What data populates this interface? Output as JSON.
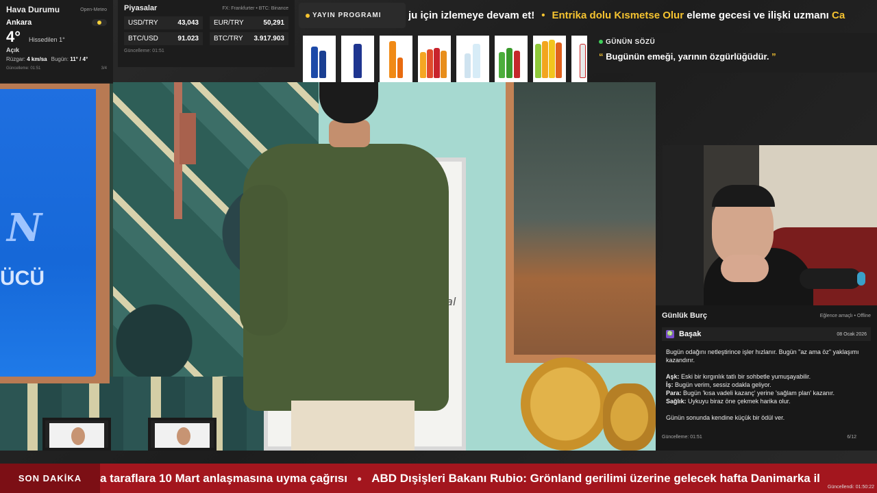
{
  "weather": {
    "title": "Hava Durumu",
    "source": "Open-Meteo",
    "city": "Ankara",
    "temperature": "4°",
    "feels_like": "Hissedilen 1°",
    "condition": "Açık",
    "wind_label": "Rüzgar:",
    "wind_value": "4 km/sa",
    "today_label": "Bugün:",
    "today_value": "11° / 4°",
    "updated": "Güncelleme: 01:51",
    "page": "3/4"
  },
  "markets": {
    "title": "Piyasalar",
    "source": "FX: Frankfurter • BTC: Binance",
    "rates": [
      {
        "pair": "USD/TRY",
        "value": "43,043"
      },
      {
        "pair": "EUR/TRY",
        "value": "50,291"
      },
      {
        "pair": "BTC/USD",
        "value": "91.023"
      },
      {
        "pair": "BTC/TRY",
        "value": "3.917.903"
      }
    ],
    "updated": "Güncelleme: 01:51"
  },
  "program": {
    "label": "YAYIN PROGRAMI",
    "ticker_part1": "ju için izlemeye devam et!",
    "ticker_highlight": "Entrika dolu Kısmetse Olur",
    "ticker_part2": "eleme gecesi ve ilişki uzmanı",
    "ticker_tail": "Ca"
  },
  "quote": {
    "title": "GÜNÜN SÖZÜ",
    "text": "Bugünün emeği, yarının özgürlüğüdür."
  },
  "video_scene": {
    "sign_text": "ÜCÜ",
    "board_scribble": "nal"
  },
  "horoscope": {
    "title": "Günlük Burç",
    "meta": "Eğlence amaçlı • Offline",
    "sign_icon": "♍",
    "sign": "Başak",
    "date": "08 Ocak 2026",
    "intro": "Bugün odağını netleştirince işler hızlanır. Bugün \"az ama öz\" yaklaşımı kazandırır.",
    "love_label": "Aşk:",
    "love": "Eski bir kırgınlık tatlı bir sohbetle yumuşayabilir.",
    "work_label": "İş:",
    "work": "Bugün verim, sessiz odakla geliyor.",
    "money_label": "Para:",
    "money": "Bugün 'kısa vadeli kazanç' yerine 'sağlam plan' kazanır.",
    "health_label": "Sağlık:",
    "health": "Uykuyu biraz öne çekmek harika olur.",
    "outro": "Günün sonunda kendine küçük bir ödül ver.",
    "updated": "Güncelleme: 01:51",
    "page": "6/12"
  },
  "news": {
    "label": "SON DAKİKA",
    "item1": "a taraflara 10 Mart anlaşmasına uyma çağrısı",
    "item2": "ABD Dışişleri Bakanı Rubio: Grönland gerilimi üzerine gelecek hafta Danimarka il",
    "updated": "Güncellendi: 01:50:22"
  },
  "colors": {
    "accent": "#f5c330",
    "breaking": "#a3161e",
    "live_dot": "#3fcf5a"
  }
}
